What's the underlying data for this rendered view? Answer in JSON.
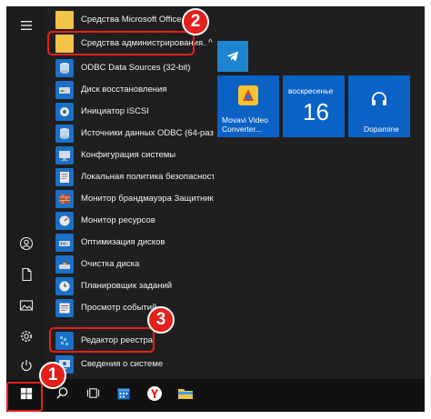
{
  "start_menu": {
    "app_list": [
      {
        "label": "Средства Microsoft Office",
        "icon": "folder-icon"
      },
      {
        "label": "Средства администрирования...",
        "icon": "folder-icon",
        "expanded_glyph": "^"
      },
      {
        "label": "ODBC Data Sources (32-bit)",
        "icon": "odbc-icon"
      },
      {
        "label": "Диск восстановления",
        "icon": "recovery-drive-icon"
      },
      {
        "label": "Инициатор iSCSI",
        "icon": "iscsi-icon"
      },
      {
        "label": "Источники данных ODBC (64-раз...",
        "icon": "odbc-icon"
      },
      {
        "label": "Конфигурация системы",
        "icon": "system-config-icon"
      },
      {
        "label": "Локальная политика безопасности",
        "icon": "security-policy-icon"
      },
      {
        "label": "Монитор брандмауэра Защитник...",
        "icon": "firewall-icon"
      },
      {
        "label": "Монитор ресурсов",
        "icon": "resource-monitor-icon"
      },
      {
        "label": "Оптимизация дисков",
        "icon": "defrag-icon"
      },
      {
        "label": "Очистка диска",
        "icon": "disk-cleanup-icon"
      },
      {
        "label": "Планировщик заданий",
        "icon": "task-scheduler-icon"
      },
      {
        "label": "Просмотр событий",
        "icon": "event-viewer-icon"
      },
      {
        "label": "Редактор реестра",
        "icon": "registry-editor-icon"
      },
      {
        "label": "Сведения о системе",
        "icon": "system-info-icon"
      }
    ],
    "tiles": {
      "telegram": {
        "icon": "telegram-icon"
      },
      "movavi": {
        "label": "Movavi Video Converter..."
      },
      "calendar": {
        "day_name": "воскресенье",
        "day_number": "16"
      },
      "dopamine": {
        "label": "Dopamine"
      }
    }
  },
  "callouts": [
    "1",
    "2",
    "3"
  ],
  "colors": {
    "accent": "#1b6fc7",
    "tile_blue": "#0a62c4",
    "telegram_tile": "#1d85cf",
    "highlight_red": "#e4201b",
    "background": "#1f1f1f"
  }
}
